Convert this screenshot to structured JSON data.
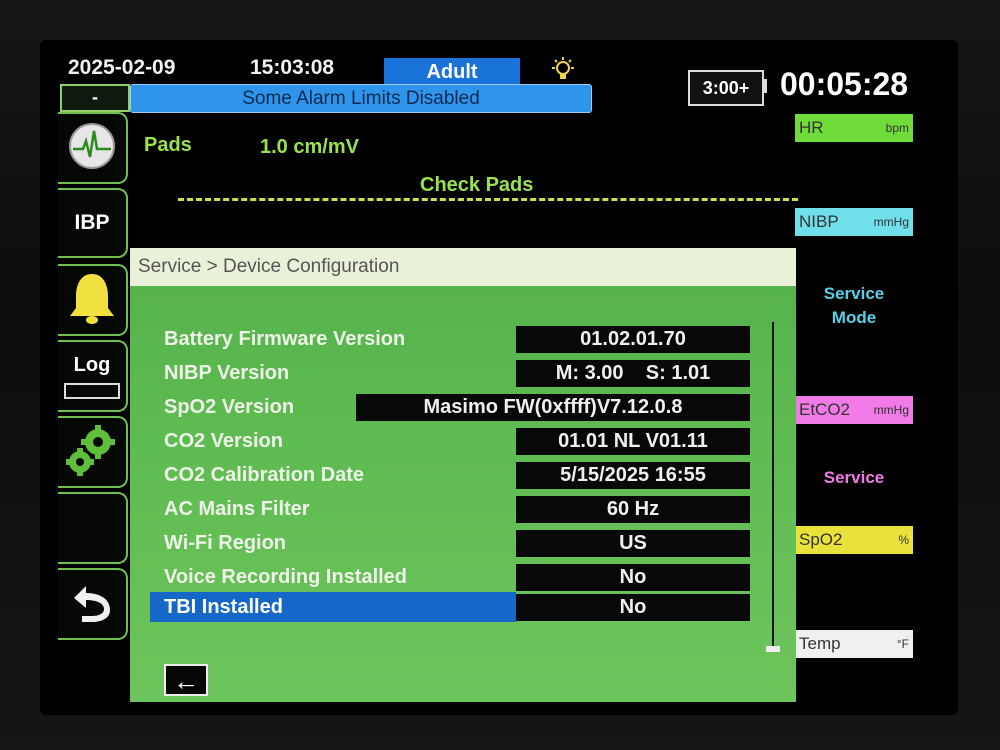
{
  "header": {
    "date": "2025-02-09",
    "time": "15:03:08",
    "patient_mode": "Adult",
    "alarm_status": "Some Alarm Limits Disabled",
    "minus_label": "-",
    "battery": "3:00+",
    "elapsed": "00:05:28"
  },
  "sidebar": {
    "ibp": "IBP",
    "log": "Log"
  },
  "ecg": {
    "lead": "Pads",
    "gain": "1.0 cm/mV",
    "message": "Check Pads"
  },
  "params": {
    "hr": {
      "label": "HR",
      "unit": "bpm"
    },
    "nibp": {
      "label": "NIBP",
      "unit": "mmHg"
    },
    "service_mode_line1": "Service",
    "service_mode_line2": "Mode",
    "etco2": {
      "label": "EtCO2",
      "unit": "mmHg"
    },
    "service": "Service",
    "spo2": {
      "label": "SpO2",
      "unit": "%"
    },
    "temp": {
      "label": "Temp",
      "unit": "°F"
    }
  },
  "dialog": {
    "title": "Service > Device Configuration",
    "rows": [
      {
        "label": "Battery Firmware Version",
        "value": "01.02.01.70"
      },
      {
        "label": "NIBP Version",
        "value": "M: 3.00    S: 1.01"
      },
      {
        "label": "SpO2 Version",
        "value": "Masimo FW(0xffff)V7.12.0.8"
      },
      {
        "label": "CO2 Version",
        "value": "01.01 NL V01.11"
      },
      {
        "label": "CO2 Calibration Date",
        "value": "5/15/2025 16:55"
      },
      {
        "label": "AC Mains Filter",
        "value": "60 Hz"
      },
      {
        "label": "Wi-Fi Region",
        "value": "US"
      },
      {
        "label": "Voice Recording Installed",
        "value": "No"
      },
      {
        "label": "TBI Installed",
        "value": "No"
      }
    ]
  },
  "colors": {
    "accent_blue": "#1a73d9",
    "ecg_green": "#9be34b",
    "hr_green": "#6fdc3a",
    "nibp_cyan": "#6fe0ea",
    "etco2_pink": "#f07ae6",
    "spo2_yellow": "#e8e23a",
    "temp_white": "#f0f0f0"
  }
}
